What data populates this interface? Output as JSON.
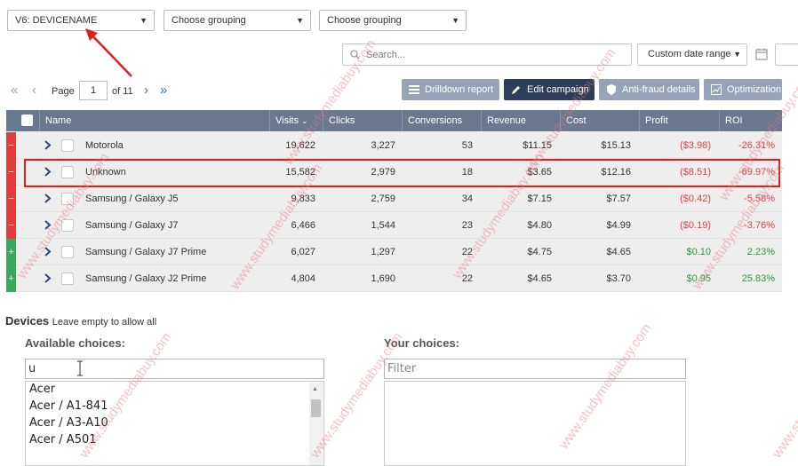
{
  "grouping": {
    "primary": "V6: DEVICENAME",
    "secondary": "Choose grouping",
    "tertiary": "Choose grouping"
  },
  "search": {
    "placeholder": "Search..."
  },
  "date_range": {
    "label": "Custom date range"
  },
  "pager": {
    "page_label": "Page",
    "page": "1",
    "of_label": "of 11"
  },
  "actions": {
    "drilldown": "Drilldown report",
    "edit_campaign": "Edit campaign",
    "antifraud": "Anti-fraud details",
    "optimization": "Optimization"
  },
  "table": {
    "columns": {
      "name": "Name",
      "visits": "Visits",
      "clicks": "Clicks",
      "conversions": "Conversions",
      "revenue": "Revenue",
      "cost": "Cost",
      "profit": "Profit",
      "roi": "ROI"
    },
    "rows": [
      {
        "status": "−",
        "name": "Motorola",
        "visits": "19,622",
        "clicks": "3,227",
        "conversions": "53",
        "revenue": "$11.15",
        "cost": "$15.13",
        "profit": "($3.98)",
        "roi": "-26.31%"
      },
      {
        "status": "−",
        "name": "Unknown",
        "visits": "15,582",
        "clicks": "2,979",
        "conversions": "18",
        "revenue": "$3.65",
        "cost": "$12.16",
        "profit": "($8.51)",
        "roi": "-69.97%"
      },
      {
        "status": "−",
        "name": "Samsung / Galaxy J5",
        "visits": "9,833",
        "clicks": "2,759",
        "conversions": "34",
        "revenue": "$7.15",
        "cost": "$7.57",
        "profit": "($0.42)",
        "roi": "-5.58%"
      },
      {
        "status": "−",
        "name": "Samsung / Galaxy J7",
        "visits": "6,466",
        "clicks": "1,544",
        "conversions": "23",
        "revenue": "$4.80",
        "cost": "$4.99",
        "profit": "($0.19)",
        "roi": "-3.76%"
      },
      {
        "status": "+",
        "name": "Samsung / Galaxy J7 Prime",
        "visits": "6,027",
        "clicks": "1,297",
        "conversions": "22",
        "revenue": "$4.75",
        "cost": "$4.65",
        "profit": "$0.10",
        "roi": "2.23%"
      },
      {
        "status": "+",
        "name": "Samsung / Galaxy J2 Prime",
        "visits": "4,804",
        "clicks": "1,690",
        "conversions": "22",
        "revenue": "$4.65",
        "cost": "$3.70",
        "profit": "$0.95",
        "roi": "25.83%"
      }
    ]
  },
  "devices": {
    "title": "Devices",
    "help": "Leave empty to allow all",
    "available_label": "Available choices:",
    "your_label": "Your choices:",
    "available_filter_value": "u",
    "your_filter_placeholder": "Filter",
    "available_options": [
      "Acer",
      "Acer / A1-841",
      "Acer / A3-A10",
      "Acer / A501"
    ]
  },
  "watermark": "www.studymediabuy.com",
  "colors": {
    "negative": "#e23c3c",
    "positive": "#3aa85a",
    "header": "#6a7890",
    "highlight": "#e01e1e"
  }
}
